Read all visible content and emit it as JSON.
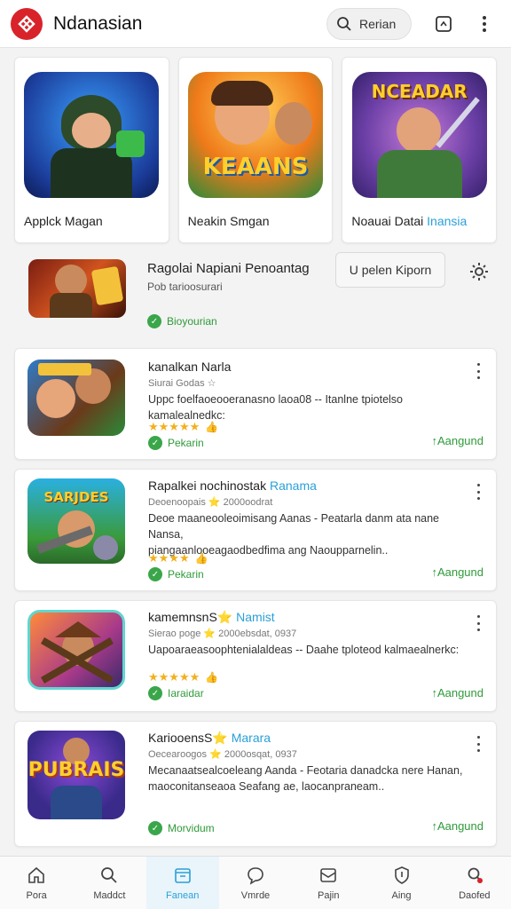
{
  "header": {
    "title": "Ndanasian",
    "search_label": "Rerian",
    "colors": {
      "brand": "#d8232a",
      "accent": "#2aa0d8",
      "success": "#2f9a3a"
    }
  },
  "featured": [
    {
      "label": "Applck Magan",
      "highlight": ""
    },
    {
      "label": "Neakin Smgan",
      "highlight": "",
      "art_text": "KEAANS"
    },
    {
      "label": "Noauai Datai ",
      "highlight": "Inansia",
      "art_text": "NCEADAR"
    }
  ],
  "promo": {
    "title": "Ragolai Napiani Penoantag",
    "subtitle": "Pob tarioosurari",
    "badge": "Bioyourian",
    "cta": "U pelen Kiporn"
  },
  "list": [
    {
      "name": "kanalkan Narla",
      "name_hl": "",
      "meta": "Siurai Godas ☆",
      "desc1": "Uppc foelfaoeooeranasno laoa08 -- Itanlne tpiotelso kamalealnedkc:",
      "desc2": "",
      "rating": 5,
      "badge": "Pekarin",
      "install": "Aangund"
    },
    {
      "name": "Rapalkei nochinostak ",
      "name_hl": "Ranama",
      "meta": "Deoenoopais ⭐ 2000oodrat",
      "desc1": "Deoe maaneooleoimisang Aanas - Peatarla danm ata nane Nansa,",
      "desc2": "piangaanlooeagaodbedfima ang Naoupparnelin..",
      "rating": 4,
      "badge": "Pekarin",
      "install": "Aangund"
    },
    {
      "name": "kamemnsnS⭐ ",
      "name_hl": "Namist",
      "meta": "Sierao poge ⭐ 2000ebsdat, 0937",
      "desc1": "Uapoaraeasoophtenialaldeas -- Daahe tploteod kalmaealnerkc:",
      "desc2": "",
      "rating": 5,
      "badge": "Iaraidar",
      "install": "Aangund"
    },
    {
      "name": "KariooensS⭐ ",
      "name_hl": "Marara",
      "meta": "Oecearoogos ⭐ 2000osqat, 0937",
      "desc1": "Mecanaatsealcoeleang Aanda - Feotaria danadcka nere Hanan,",
      "desc2": "maoconitanseaoa Seafang ae, laocanpraneam..",
      "rating": 0,
      "badge": "Morvidum",
      "install": "Aangund"
    }
  ],
  "nav": [
    {
      "label": "Pora",
      "icon": "home-icon"
    },
    {
      "label": "Maddct",
      "icon": "search-icon"
    },
    {
      "label": "Fanean",
      "icon": "apps-icon",
      "active": true
    },
    {
      "label": "Vmrde",
      "icon": "chat-icon"
    },
    {
      "label": "Pajin",
      "icon": "inbox-icon"
    },
    {
      "label": "Aing",
      "icon": "shield-icon"
    },
    {
      "label": "Daofed",
      "icon": "profile-icon"
    }
  ]
}
